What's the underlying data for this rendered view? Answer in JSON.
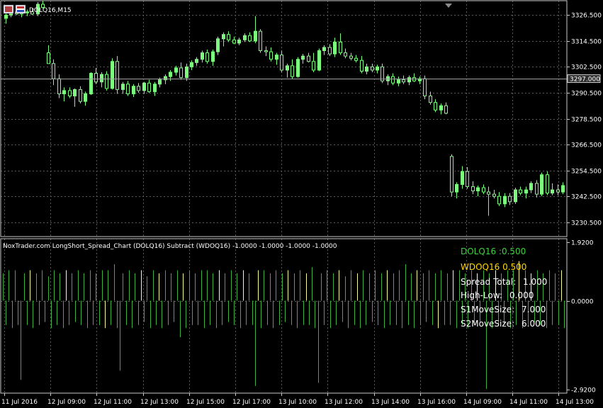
{
  "window": {
    "symbol_title": "DOLQ16,M15"
  },
  "indicator": {
    "title": "NoxTrader.com LongShort_Spread_Chart (DOLQ16) Subtract (WDOQ16) -1.0000 -1.0000 -1.0000 -1.0000"
  },
  "colors": {
    "background": "#000000",
    "grid": "#5a5a5a",
    "frame": "#c8c8c8",
    "bull": "#7cfc7c",
    "bear": "#000000",
    "wick": "#7cfc7c",
    "spread_green": "#3cb03c",
    "spread_yellow": "#ffff99",
    "info_green": "#3cd23c",
    "info_yellow": "#ffd700",
    "info_white": "#ffffff"
  },
  "info_box": {
    "dol_label": "DOLQ16 :0.500",
    "wdo_label": "WDOQ16  0.500",
    "rows": [
      {
        "label": "Spread Total:",
        "value": "1.000"
      },
      {
        "label": "High-Low:",
        "value": "0.000"
      },
      {
        "label": "S1MoveSize:",
        "value": "7.000"
      },
      {
        "label": "S2MoveSize:",
        "value": "6.000"
      }
    ]
  },
  "chart_data": [
    {
      "type": "candlestick",
      "price_axis": {
        "ylim": [
          3224.5,
          3332.5
        ],
        "ticks": [
          "3326.500",
          "3314.500",
          "3302.500",
          "3290.500",
          "3278.500",
          "3266.500",
          "3254.500",
          "3242.500",
          "3230.500"
        ],
        "tick_values": [
          3326.5,
          3314.5,
          3302.5,
          3290.5,
          3278.5,
          3266.5,
          3254.5,
          3242.5,
          3230.5
        ],
        "current_price": "3297.000",
        "current_value": 3297.0
      },
      "time_axis": {
        "labels": [
          "11 Jul 2016",
          "12 Jul 09:00",
          "12 Jul 11:00",
          "12 Jul 13:00",
          "12 Jul 15:00",
          "12 Jul 17:00",
          "13 Jul 10:00",
          "13 Jul 12:00",
          "13 Jul 14:00",
          "13 Jul 16:00",
          "14 Jul 09:00",
          "14 Jul 11:00",
          "14 Jul 13:00"
        ],
        "grid_lines": 13
      },
      "candles": [
        {
          "o": 3325.0,
          "h": 3327.5,
          "l": 3322.5,
          "c": 3326.5
        },
        {
          "o": 3326.5,
          "h": 3329.0,
          "l": 3325.5,
          "c": 3328.0
        },
        {
          "o": 3328.0,
          "h": 3329.5,
          "l": 3326.5,
          "c": 3327.0
        },
        {
          "o": 3327.0,
          "h": 3328.5,
          "l": 3325.5,
          "c": 3327.5
        },
        {
          "o": 3327.5,
          "h": 3329.0,
          "l": 3326.0,
          "c": 3328.0
        },
        {
          "o": 3328.0,
          "h": 3329.5,
          "l": 3326.5,
          "c": 3327.0
        },
        {
          "o": 3327.0,
          "h": 3332.5,
          "l": 3326.0,
          "c": 3331.5
        },
        {
          "o": 3331.5,
          "h": 3333.0,
          "l": 3329.5,
          "c": 3330.0
        },
        {
          "o": 3309.0,
          "h": 3312.5,
          "l": 3304.0,
          "c": 3304.0
        },
        {
          "o": 3304.0,
          "h": 3306.0,
          "l": 3294.0,
          "c": 3297.0
        },
        {
          "o": 3297.0,
          "h": 3299.0,
          "l": 3288.0,
          "c": 3290.0
        },
        {
          "o": 3290.0,
          "h": 3293.0,
          "l": 3286.5,
          "c": 3291.5
        },
        {
          "o": 3291.5,
          "h": 3293.0,
          "l": 3288.0,
          "c": 3289.0
        },
        {
          "o": 3289.0,
          "h": 3292.5,
          "l": 3284.0,
          "c": 3292.0
        },
        {
          "o": 3292.0,
          "h": 3293.5,
          "l": 3285.5,
          "c": 3286.5
        },
        {
          "o": 3286.5,
          "h": 3291.0,
          "l": 3284.5,
          "c": 3290.0
        },
        {
          "o": 3290.0,
          "h": 3300.0,
          "l": 3289.5,
          "c": 3299.5
        },
        {
          "o": 3299.5,
          "h": 3302.0,
          "l": 3294.5,
          "c": 3295.5
        },
        {
          "o": 3295.5,
          "h": 3300.0,
          "l": 3293.0,
          "c": 3299.0
        },
        {
          "o": 3299.0,
          "h": 3300.5,
          "l": 3291.5,
          "c": 3292.5
        },
        {
          "o": 3292.5,
          "h": 3306.5,
          "l": 3292.0,
          "c": 3305.0
        },
        {
          "o": 3305.0,
          "h": 3307.5,
          "l": 3290.0,
          "c": 3292.0
        },
        {
          "o": 3292.0,
          "h": 3295.5,
          "l": 3290.0,
          "c": 3294.5
        },
        {
          "o": 3294.5,
          "h": 3296.0,
          "l": 3289.0,
          "c": 3290.0
        },
        {
          "o": 3290.0,
          "h": 3294.5,
          "l": 3288.5,
          "c": 3293.5
        },
        {
          "o": 3293.5,
          "h": 3295.0,
          "l": 3290.5,
          "c": 3291.5
        },
        {
          "o": 3291.5,
          "h": 3295.5,
          "l": 3290.0,
          "c": 3295.0
        },
        {
          "o": 3295.0,
          "h": 3296.5,
          "l": 3290.5,
          "c": 3291.0
        },
        {
          "o": 3291.0,
          "h": 3295.5,
          "l": 3289.0,
          "c": 3294.5
        },
        {
          "o": 3294.5,
          "h": 3297.5,
          "l": 3293.0,
          "c": 3296.5
        },
        {
          "o": 3296.5,
          "h": 3299.0,
          "l": 3294.5,
          "c": 3298.0
        },
        {
          "o": 3298.0,
          "h": 3301.0,
          "l": 3296.0,
          "c": 3300.0
        },
        {
          "o": 3300.0,
          "h": 3303.0,
          "l": 3298.5,
          "c": 3302.0
        },
        {
          "o": 3302.0,
          "h": 3304.5,
          "l": 3296.5,
          "c": 3297.5
        },
        {
          "o": 3297.5,
          "h": 3304.0,
          "l": 3296.0,
          "c": 3302.5
        },
        {
          "o": 3302.5,
          "h": 3305.5,
          "l": 3301.0,
          "c": 3304.5
        },
        {
          "o": 3304.5,
          "h": 3307.0,
          "l": 3303.0,
          "c": 3306.0
        },
        {
          "o": 3306.0,
          "h": 3310.0,
          "l": 3304.5,
          "c": 3309.0
        },
        {
          "o": 3309.0,
          "h": 3310.5,
          "l": 3304.0,
          "c": 3305.0
        },
        {
          "o": 3305.0,
          "h": 3310.5,
          "l": 3303.0,
          "c": 3309.5
        },
        {
          "o": 3309.5,
          "h": 3316.5,
          "l": 3308.0,
          "c": 3315.5
        },
        {
          "o": 3315.5,
          "h": 3318.5,
          "l": 3312.0,
          "c": 3317.5
        },
        {
          "o": 3317.5,
          "h": 3319.0,
          "l": 3314.0,
          "c": 3315.0
        },
        {
          "o": 3315.0,
          "h": 3316.5,
          "l": 3313.0,
          "c": 3313.5
        },
        {
          "o": 3313.5,
          "h": 3316.0,
          "l": 3312.5,
          "c": 3315.0
        },
        {
          "o": 3315.0,
          "h": 3318.0,
          "l": 3314.0,
          "c": 3317.0
        },
        {
          "o": 3317.0,
          "h": 3318.5,
          "l": 3314.0,
          "c": 3314.5
        },
        {
          "o": 3314.5,
          "h": 3326.0,
          "l": 3313.5,
          "c": 3319.0
        },
        {
          "o": 3319.0,
          "h": 3320.0,
          "l": 3309.0,
          "c": 3310.0
        },
        {
          "o": 3310.0,
          "h": 3312.0,
          "l": 3307.5,
          "c": 3309.5
        },
        {
          "o": 3309.5,
          "h": 3311.5,
          "l": 3305.0,
          "c": 3306.0
        },
        {
          "o": 3306.0,
          "h": 3309.0,
          "l": 3303.5,
          "c": 3308.0
        },
        {
          "o": 3308.0,
          "h": 3310.0,
          "l": 3300.0,
          "c": 3301.0
        },
        {
          "o": 3301.0,
          "h": 3304.0,
          "l": 3297.5,
          "c": 3303.0
        },
        {
          "o": 3303.0,
          "h": 3306.0,
          "l": 3297.0,
          "c": 3298.0
        },
        {
          "o": 3298.0,
          "h": 3307.0,
          "l": 3297.5,
          "c": 3306.0
        },
        {
          "o": 3306.0,
          "h": 3308.5,
          "l": 3304.0,
          "c": 3307.5
        },
        {
          "o": 3307.5,
          "h": 3309.0,
          "l": 3304.5,
          "c": 3305.0
        },
        {
          "o": 3305.0,
          "h": 3309.0,
          "l": 3300.0,
          "c": 3301.0
        },
        {
          "o": 3301.0,
          "h": 3311.0,
          "l": 3300.5,
          "c": 3310.0
        },
        {
          "o": 3310.0,
          "h": 3312.5,
          "l": 3308.0,
          "c": 3311.5
        },
        {
          "o": 3311.5,
          "h": 3313.0,
          "l": 3307.5,
          "c": 3308.5
        },
        {
          "o": 3308.5,
          "h": 3316.0,
          "l": 3307.0,
          "c": 3314.0
        },
        {
          "o": 3314.0,
          "h": 3318.0,
          "l": 3308.0,
          "c": 3309.0
        },
        {
          "o": 3309.0,
          "h": 3311.0,
          "l": 3306.5,
          "c": 3307.5
        },
        {
          "o": 3307.5,
          "h": 3309.0,
          "l": 3305.5,
          "c": 3306.5
        },
        {
          "o": 3306.5,
          "h": 3308.0,
          "l": 3304.5,
          "c": 3305.5
        },
        {
          "o": 3305.5,
          "h": 3307.5,
          "l": 3299.5,
          "c": 3300.5
        },
        {
          "o": 3300.5,
          "h": 3304.0,
          "l": 3299.0,
          "c": 3302.5
        },
        {
          "o": 3302.5,
          "h": 3304.0,
          "l": 3300.0,
          "c": 3301.0
        },
        {
          "o": 3301.0,
          "h": 3303.5,
          "l": 3299.5,
          "c": 3302.5
        },
        {
          "o": 3302.5,
          "h": 3304.0,
          "l": 3295.0,
          "c": 3296.0
        },
        {
          "o": 3296.0,
          "h": 3299.0,
          "l": 3294.0,
          "c": 3298.0
        },
        {
          "o": 3298.0,
          "h": 3299.5,
          "l": 3294.0,
          "c": 3295.0
        },
        {
          "o": 3295.0,
          "h": 3298.0,
          "l": 3293.5,
          "c": 3296.5
        },
        {
          "o": 3296.5,
          "h": 3298.5,
          "l": 3294.5,
          "c": 3295.5
        },
        {
          "o": 3295.5,
          "h": 3298.5,
          "l": 3294.0,
          "c": 3297.5
        },
        {
          "o": 3297.5,
          "h": 3299.5,
          "l": 3295.5,
          "c": 3296.0
        },
        {
          "o": 3296.0,
          "h": 3298.0,
          "l": 3294.5,
          "c": 3297.0
        },
        {
          "o": 3297.0,
          "h": 3298.5,
          "l": 3287.5,
          "c": 3289.0
        },
        {
          "o": 3289.0,
          "h": 3291.0,
          "l": 3285.0,
          "c": 3286.0
        },
        {
          "o": 3286.0,
          "h": 3287.5,
          "l": 3281.5,
          "c": 3282.5
        },
        {
          "o": 3282.5,
          "h": 3285.5,
          "l": 3280.5,
          "c": 3284.5
        },
        {
          "o": 3284.5,
          "h": 3286.0,
          "l": 3280.5,
          "c": 3281.0
        },
        {
          "o": 3261.0,
          "h": 3262.0,
          "l": 3242.5,
          "c": 3244.5
        },
        {
          "o": 3244.5,
          "h": 3249.0,
          "l": 3241.5,
          "c": 3248.0
        },
        {
          "o": 3248.0,
          "h": 3256.5,
          "l": 3246.0,
          "c": 3254.0
        },
        {
          "o": 3254.0,
          "h": 3256.0,
          "l": 3246.0,
          "c": 3247.0
        },
        {
          "o": 3247.0,
          "h": 3249.5,
          "l": 3243.5,
          "c": 3245.0
        },
        {
          "o": 3245.0,
          "h": 3247.5,
          "l": 3242.5,
          "c": 3246.5
        },
        {
          "o": 3246.5,
          "h": 3248.0,
          "l": 3243.5,
          "c": 3244.5
        },
        {
          "o": 3244.5,
          "h": 3247.0,
          "l": 3233.5,
          "c": 3243.5
        },
        {
          "o": 3243.5,
          "h": 3245.5,
          "l": 3241.5,
          "c": 3242.5
        },
        {
          "o": 3242.5,
          "h": 3244.5,
          "l": 3238.0,
          "c": 3239.0
        },
        {
          "o": 3239.0,
          "h": 3244.0,
          "l": 3237.5,
          "c": 3242.5
        },
        {
          "o": 3242.5,
          "h": 3244.0,
          "l": 3238.5,
          "c": 3240.0
        },
        {
          "o": 3240.0,
          "h": 3246.5,
          "l": 3239.0,
          "c": 3245.5
        },
        {
          "o": 3245.5,
          "h": 3247.0,
          "l": 3243.0,
          "c": 3244.0
        },
        {
          "o": 3244.0,
          "h": 3247.0,
          "l": 3241.5,
          "c": 3245.5
        },
        {
          "o": 3245.5,
          "h": 3249.5,
          "l": 3244.0,
          "c": 3248.5
        },
        {
          "o": 3248.5,
          "h": 3250.0,
          "l": 3242.0,
          "c": 3243.5
        },
        {
          "o": 3243.5,
          "h": 3253.5,
          "l": 3242.5,
          "c": 3252.5
        },
        {
          "o": 3252.5,
          "h": 3254.0,
          "l": 3243.0,
          "c": 3244.0
        },
        {
          "o": 3244.0,
          "h": 3248.5,
          "l": 3243.0,
          "c": 3245.5
        },
        {
          "o": 3245.5,
          "h": 3248.0,
          "l": 3243.0,
          "c": 3244.5
        },
        {
          "o": 3244.5,
          "h": 3249.0,
          "l": 3243.5,
          "c": 3247.5
        }
      ]
    },
    {
      "type": "bar",
      "subtype": "spread_histogram",
      "ylim": [
        -2.92,
        1.92
      ],
      "ticks": [
        "1.9200",
        "0.0000",
        "-2.9200"
      ],
      "tick_values": [
        1.92,
        0.0,
        -2.92
      ],
      "series": [
        {
          "values": [
            0.9,
            -0.8,
            1.0,
            -0.9,
            1.0,
            -0.8,
            -2.6,
            0.9,
            -0.8,
            1.0,
            -0.9,
            0.9,
            -0.8,
            1.0,
            -0.7,
            0.8,
            -0.9,
            1.0,
            -0.8,
            0.9,
            -0.9,
            1.0,
            -0.8,
            0.9,
            -0.7,
            1.0,
            -0.8,
            0.9,
            -0.9,
            1.0,
            -0.8,
            0.9,
            -0.8,
            1.0,
            -0.9,
            1.0,
            -0.8,
            1.2,
            -0.9,
            -2.3,
            0.9,
            -0.8,
            1.0,
            -0.9,
            0.9,
            -0.8,
            1.0,
            -0.7,
            0.8,
            -0.9,
            1.0,
            -0.8,
            0.9,
            -0.9,
            1.0,
            -0.8,
            0.9,
            -0.7,
            1.0,
            -1.2,
            0.9,
            -0.9,
            1.0,
            -0.8,
            0.9,
            -0.8,
            1.0,
            -0.9,
            1.0,
            -0.8,
            0.9,
            -0.9,
            1.0,
            -0.8,
            0.9,
            -0.7,
            1.0,
            -0.8,
            0.9,
            -0.9,
            1.0,
            -0.8,
            0.9,
            -0.8,
            -2.8,
            1.0,
            -0.9,
            1.0,
            -0.8,
            0.9,
            -0.9,
            1.0,
            -0.8,
            0.9,
            -0.7,
            1.0,
            -0.8,
            0.9,
            -0.9,
            1.0,
            -0.8,
            0.9,
            -0.8,
            1.1,
            -0.9,
            -2.7,
            0.9,
            -0.8,
            1.0,
            -0.9,
            0.9,
            -0.8,
            1.0,
            -0.7,
            0.8,
            -0.9,
            1.0,
            -0.8,
            0.9,
            -0.9,
            1.0,
            -0.8,
            0.9,
            -0.7,
            1.0,
            -0.8,
            0.9,
            -0.9,
            1.0,
            -0.8,
            0.9,
            -0.8,
            1.0,
            -0.9,
            1.2,
            -0.8,
            0.9,
            -0.9,
            1.0,
            -0.8,
            0.9,
            -0.7,
            1.0,
            -0.8,
            0.9,
            -0.9,
            1.0,
            -0.8,
            0.9,
            -0.8,
            1.0,
            -0.9,
            1.0,
            -0.8,
            0.9,
            -0.9,
            1.0,
            -0.8,
            0.9,
            -0.7,
            1.0,
            -2.9,
            0.9,
            -0.9,
            1.0,
            -0.8,
            0.9,
            -0.8,
            1.0,
            -0.9,
            1.0,
            -0.8,
            1.3,
            -0.9,
            1.0,
            -0.8,
            0.9,
            -0.7,
            1.0,
            -0.8,
            0.9,
            -0.9,
            1.0,
            -0.8,
            0.9,
            -0.8,
            1.0,
            -0.9
          ],
          "yellow_indices": [
            9,
            21,
            34,
            46,
            52,
            60,
            72,
            80,
            85,
            95,
            101,
            112,
            118,
            128,
            138,
            145,
            150,
            158,
            164,
            172,
            176,
            186
          ]
        }
      ]
    }
  ]
}
